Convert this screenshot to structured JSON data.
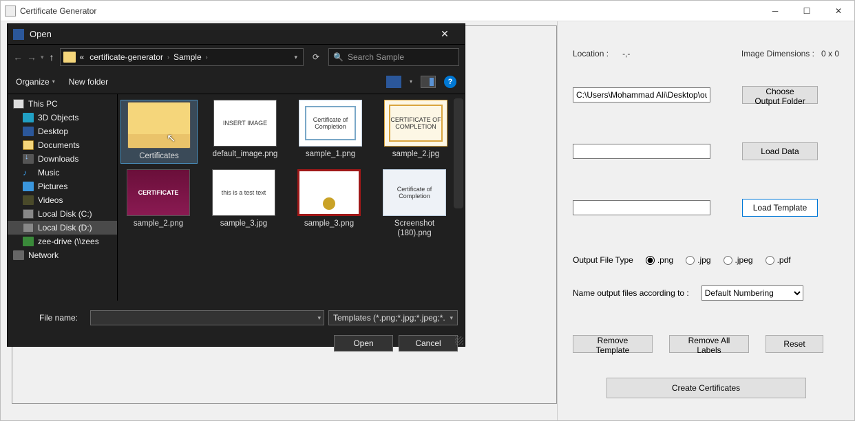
{
  "app": {
    "title": "Certificate Generator"
  },
  "dialog": {
    "title": "Open",
    "breadcrumbs": [
      "«",
      "certificate-generator",
      "Sample"
    ],
    "search_placeholder": "Search Sample",
    "organize": "Organize",
    "new_folder": "New folder",
    "tree": [
      {
        "label": "This PC",
        "icon": "pc",
        "root": true
      },
      {
        "label": "3D Objects",
        "icon": "3d"
      },
      {
        "label": "Desktop",
        "icon": "desktop"
      },
      {
        "label": "Documents",
        "icon": "docs"
      },
      {
        "label": "Downloads",
        "icon": "down"
      },
      {
        "label": "Music",
        "icon": "music"
      },
      {
        "label": "Pictures",
        "icon": "pics"
      },
      {
        "label": "Videos",
        "icon": "vids"
      },
      {
        "label": "Local Disk (C:)",
        "icon": "disk"
      },
      {
        "label": "Local Disk (D:)",
        "icon": "disk",
        "selected": true
      },
      {
        "label": "zee-drive (\\\\zees",
        "icon": "net"
      },
      {
        "label": "Network",
        "icon": "network",
        "root": true
      }
    ],
    "files": [
      {
        "name": "Certificates",
        "type": "folder",
        "selected": true
      },
      {
        "name": "default_image.png",
        "type": "text",
        "thumb_text": "INSERT IMAGE"
      },
      {
        "name": "sample_1.png",
        "type": "cert-blue",
        "thumb_text": "Certificate of Completion"
      },
      {
        "name": "sample_2.jpg",
        "type": "cert-gold",
        "thumb_text": "CERTIFICATE OF COMPLETION"
      },
      {
        "name": "sample_2.png",
        "type": "cert-mag",
        "thumb_text": "CERTIFICATE"
      },
      {
        "name": "sample_3.jpg",
        "type": "text",
        "thumb_text": "this is a test text"
      },
      {
        "name": "sample_3.png",
        "type": "cert-red",
        "thumb_text": ""
      },
      {
        "name": "Screenshot (180).png",
        "type": "screenshot",
        "thumb_text": "Certificate of Completion"
      }
    ],
    "file_name_label": "File name:",
    "file_name_value": "",
    "filter": "Templates  (*.png;*.jpg;*.jpeg;*.",
    "open_btn": "Open",
    "cancel_btn": "Cancel"
  },
  "side": {
    "location_label": "Location :",
    "location_value": "-,-",
    "dim_label": "Image Dimensions :",
    "dim_value": "0 x 0",
    "output_path": "C:\\Users\\Mohammad Ali\\Desktop\\out",
    "choose_output": "Choose Output Folder",
    "load_data": "Load Data",
    "load_template": "Load Template",
    "output_type_label": "Output File Type",
    "formats": [
      ".png",
      ".jpg",
      ".jpeg",
      ".pdf"
    ],
    "selected_format": ".png",
    "naming_label": "Name output files according to :",
    "naming_value": "Default Numbering",
    "remove_template": "Remove Template",
    "remove_labels": "Remove All Labels",
    "reset": "Reset",
    "create": "Create Certificates"
  }
}
